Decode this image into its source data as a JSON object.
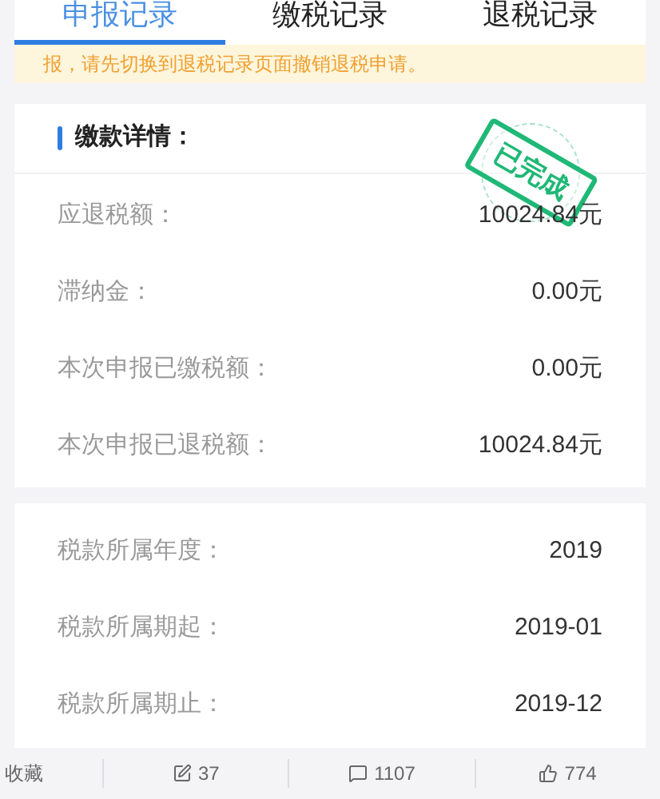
{
  "tabs": [
    {
      "label": "申报记录",
      "selected": true
    },
    {
      "label": "缴税记录",
      "selected": false
    },
    {
      "label": "退税记录",
      "selected": false
    }
  ],
  "notice": "报，请先切换到退税记录页面撤销退税申请。",
  "payment_card": {
    "title": "缴款详情：",
    "stamp": "已完成",
    "rows": [
      {
        "label": "应退税额：",
        "value": "10024.84元"
      },
      {
        "label": "滞纳金：",
        "value": "0.00元"
      },
      {
        "label": "本次申报已缴税额：",
        "value": "0.00元"
      },
      {
        "label": "本次申报已退税额：",
        "value": "10024.84元"
      }
    ]
  },
  "period_card": {
    "rows": [
      {
        "label": "税款所属年度：",
        "value": "2019"
      },
      {
        "label": "税款所属期起：",
        "value": "2019-01"
      },
      {
        "label": "税款所属期止：",
        "value": "2019-12"
      }
    ]
  },
  "footer": {
    "favorite": "收藏",
    "shares": "37",
    "comments": "1107",
    "likes": "774"
  }
}
